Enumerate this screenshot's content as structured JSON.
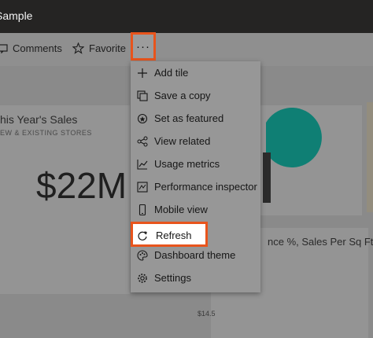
{
  "app": {
    "title": "Sample"
  },
  "toolbar": {
    "comments_label": "Comments",
    "favorite_label": "Favorite",
    "more_label": "···"
  },
  "tiles": {
    "sales_title": "his Year's Sales",
    "sales_subtitle": "EW & EXISTING STORES",
    "sales_value": "$22M",
    "bottom_title": "nce %, Sales Per Sq Ft, T",
    "axis_tick": "$14.5"
  },
  "menu": {
    "items": [
      {
        "label": "Add tile",
        "icon": "plus-icon"
      },
      {
        "label": "Save a copy",
        "icon": "save-copy-icon"
      },
      {
        "label": "Set as featured",
        "icon": "featured-icon"
      },
      {
        "label": "View related",
        "icon": "related-icon"
      },
      {
        "label": "Usage metrics",
        "icon": "metrics-icon"
      },
      {
        "label": "Performance inspector",
        "icon": "inspector-icon"
      },
      {
        "label": "Mobile view",
        "icon": "mobile-icon"
      },
      {
        "label": "Refresh",
        "icon": "refresh-icon"
      },
      {
        "label": "Dashboard theme",
        "icon": "theme-icon"
      },
      {
        "label": "Settings",
        "icon": "gear-icon"
      }
    ]
  },
  "colors": {
    "highlight": "#e8541c",
    "pie_dark": "#2b2b2b",
    "pie_teal": "#0f7f74",
    "topbar": "#252423"
  }
}
